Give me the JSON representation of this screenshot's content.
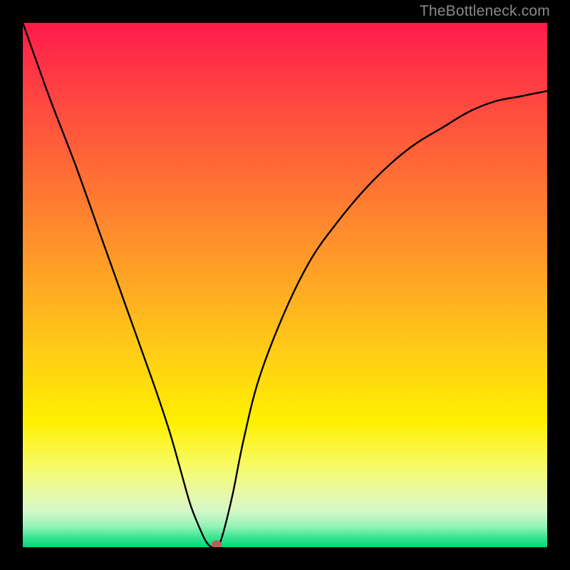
{
  "watermark": "TheBottleneck.com",
  "chart_data": {
    "type": "line",
    "title": "",
    "xlabel": "",
    "ylabel": "",
    "xlim": [
      0,
      100
    ],
    "ylim": [
      0,
      100
    ],
    "grid": false,
    "legend": false,
    "series": [
      {
        "name": "bottleneck-curve",
        "x": [
          0,
          5,
          10,
          15,
          20,
          25,
          28,
          30,
          32,
          34,
          35,
          36,
          37,
          38,
          40,
          42,
          45,
          50,
          55,
          60,
          65,
          70,
          75,
          80,
          85,
          90,
          95,
          100
        ],
        "y": [
          100,
          86,
          73,
          59,
          45,
          31,
          22,
          15,
          8,
          3,
          1,
          0,
          0,
          2,
          10,
          20,
          32,
          45,
          55,
          62,
          68,
          73,
          77,
          80,
          83,
          85,
          86,
          87
        ]
      }
    ],
    "marker": {
      "x": 37,
      "y": 0.5,
      "color": "#c05a5a"
    },
    "background_gradient": {
      "top": "#ff1a4a",
      "middle": "#fff000",
      "bottom": "#00d879"
    }
  }
}
